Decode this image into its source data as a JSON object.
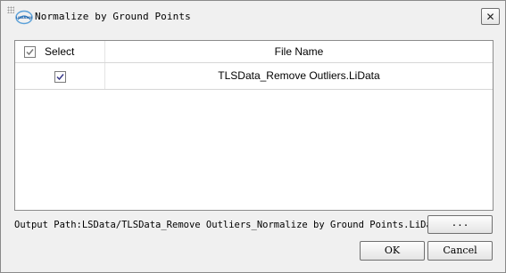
{
  "window": {
    "title": "Normalize by Ground Points",
    "close_icon": "close-icon"
  },
  "logo": {
    "text": "LIDAR360"
  },
  "table": {
    "columns": [
      "Select",
      "File Name"
    ],
    "header_checked": true,
    "rows": [
      {
        "checked": true,
        "file_name": "TLSData_Remove Outliers.LiData"
      }
    ]
  },
  "output": {
    "label": "Output Path:",
    "path": "LSData/TLSData_Remove Outliers_Normalize by Ground Points.LiData",
    "browse_label": "..."
  },
  "buttons": {
    "ok": "OK",
    "cancel": "Cancel"
  }
}
